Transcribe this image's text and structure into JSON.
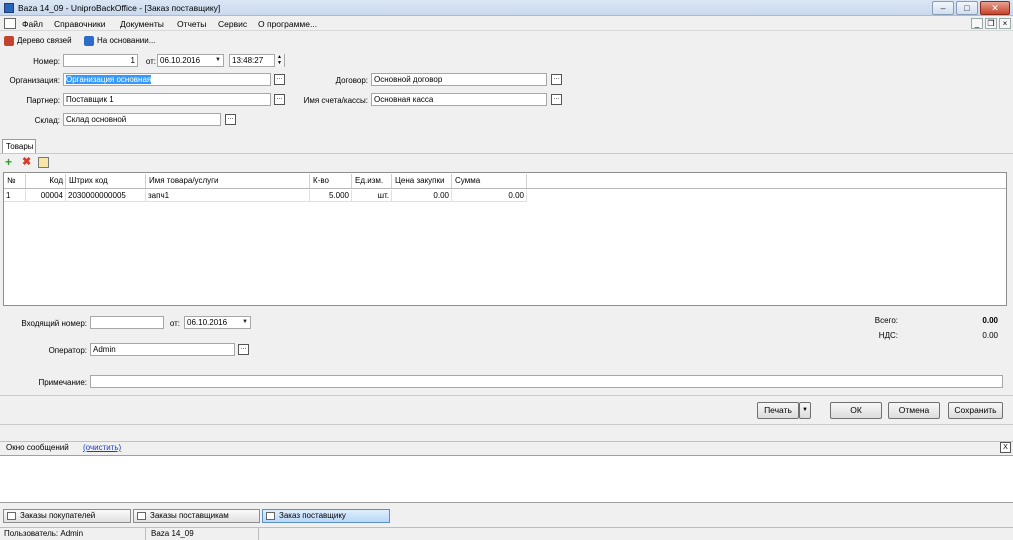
{
  "window": {
    "title": "Baza 14_09 - UniproBackOffice - [Заказ поставщику]",
    "btn_minimize": "–",
    "btn_maximize": "□",
    "btn_close": "✕"
  },
  "menu": {
    "items": [
      "Файл",
      "Справочники",
      "Документы",
      "Отчеты",
      "Сервис",
      "О программе..."
    ],
    "mdi_minimize": "_",
    "mdi_restore": "❐",
    "mdi_close": "×"
  },
  "toolbar": {
    "tree_label": "Дерево связей",
    "based_on_label": "На основании..."
  },
  "form": {
    "number_label": "Номер:",
    "number_value": "1",
    "from_label": "от:",
    "date_value": "06.10.2016",
    "time_value": "13:48:27",
    "org_label": "Организация:",
    "org_value": "Организация основная",
    "partner_label": "Партнер:",
    "partner_value": "Поставщик 1",
    "warehouse_label": "Склад:",
    "warehouse_value": "Склад основной",
    "contract_label": "Договор:",
    "contract_value": "Основной договор",
    "account_label": "Имя счета/кассы:",
    "account_value": "Основная касса"
  },
  "goods_tab": "Товары",
  "grid": {
    "headers": [
      "№",
      "Код",
      "Штрих код",
      "Имя товара/услуги",
      "К-во",
      "Ед.изм.",
      "Цена закупки",
      "Сумма"
    ],
    "rows": [
      [
        "1",
        "00004",
        "2030000000005",
        "запч1",
        "5.000",
        "шт.",
        "0.00",
        "0.00"
      ]
    ]
  },
  "footer": {
    "incoming_label": "Входящий номер:",
    "incoming_value": "",
    "from_label": "от:",
    "incoming_date": "06.10.2016",
    "operator_label": "Оператор:",
    "operator_value": "Admin",
    "note_label": "Примечание:",
    "note_value": "",
    "total_label": "Всего:",
    "total_value": "0.00",
    "vat_label": "НДС:",
    "vat_value": "0.00"
  },
  "buttons": {
    "print": "Печать",
    "ok": "ОК",
    "cancel": "Отмена",
    "save": "Сохранить"
  },
  "messages": {
    "title": "Окно сообщений",
    "clear_link": "(очистить)",
    "close": "X"
  },
  "window_tabs": [
    "Заказы покупателей",
    "Заказы поставщикам",
    "Заказ поставщику"
  ],
  "statusbar": {
    "user": "Пользователь: Admin",
    "db": "Baza 14_09"
  },
  "colors": {
    "accent": "#3399ff",
    "link": "#1a3fbf",
    "add": "#2e9d2e",
    "delete": "#d63a2a"
  }
}
